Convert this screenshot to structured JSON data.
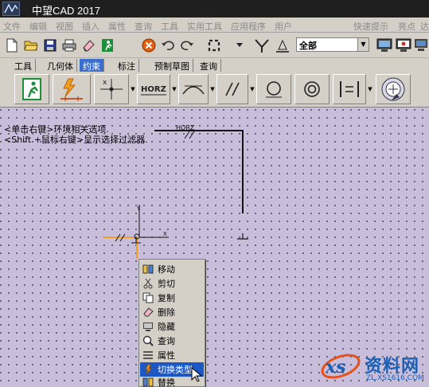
{
  "window": {
    "title": "中望CAD 2017"
  },
  "menubar": {
    "items": [
      "文件",
      "编辑",
      "视图",
      "插入",
      "属性",
      "查询",
      "工具",
      "实用工具",
      "应用程序",
      "用户",
      "快速提示",
      "亮点",
      "达"
    ]
  },
  "toolbar1": {
    "layer_value": "全部",
    "icons": [
      "new-icon",
      "open-icon",
      "save-icon",
      "print-icon",
      "eraser-icon",
      "exit-icon",
      "cancel-icon",
      "undo-icon",
      "redo-icon",
      "regen-icon",
      "pan-icon",
      "monitor-icon",
      "monitor-settings-icon",
      "display-icon"
    ]
  },
  "tabs": [
    "工具",
    "几何体",
    "约束",
    "标注",
    "预制草图",
    "查询"
  ],
  "tabs_active": "约束",
  "toolbar2": {
    "icons": [
      "exit-constraint-icon",
      "auto-constraint-icon",
      "point-constraint-icon",
      "horizontal-constraint-icon",
      "tangent-constraint-icon",
      "parallel-constraint-icon",
      "radius-constraint-icon",
      "concentric-constraint-icon",
      "equal-constraint-icon",
      "constraint-settings-icon"
    ],
    "horz_label": "HORZ"
  },
  "canvas": {
    "prompt_line1": "<单击右键>环境相关选项.",
    "prompt_line2": "<Shift +鼠标右键>显示选择过滤器.",
    "horz_annotation": "HORZ",
    "axis_y": "Y",
    "axis_x": "X"
  },
  "context_menu": {
    "items": [
      {
        "label": "移动",
        "icon": "move-icon"
      },
      {
        "label": "剪切",
        "icon": "cut-icon"
      },
      {
        "label": "复制",
        "icon": "copy-icon"
      },
      {
        "label": "删除",
        "icon": "delete-icon"
      },
      {
        "label": "隐藏",
        "icon": "hide-icon"
      },
      {
        "label": "查询",
        "icon": "query-icon"
      },
      {
        "label": "属性",
        "icon": "properties-icon"
      },
      {
        "label": "切换类型",
        "icon": "switch-type-icon"
      },
      {
        "label": "替换",
        "icon": "replace-icon"
      }
    ],
    "highlighted": "切换类型"
  },
  "watermark": {
    "brand": "资料网",
    "url": "ZL.XS1616.COM"
  },
  "colors": {
    "canvas_bg": "#c8bedc",
    "menu_highlight": "#1c57c6",
    "tab_active": "#3b6fcf",
    "constraint_orange": "#f0a020"
  }
}
